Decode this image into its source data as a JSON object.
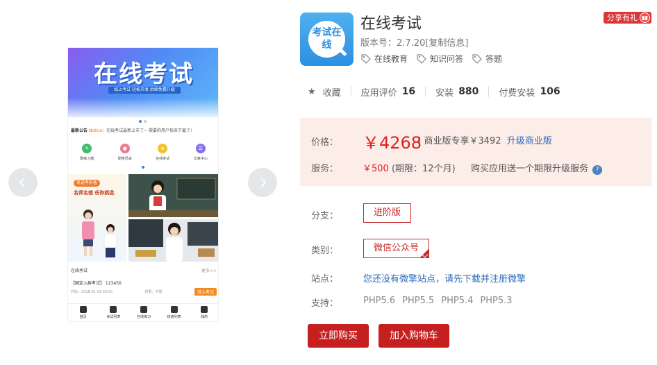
{
  "carousel": {
    "phone": {
      "banner_title": "在线考试",
      "banner_sub": "线上考试 轻松开发 后续免费升级",
      "notice_label": "最新公告",
      "notice_en": "Notice",
      "notice_text": "：在线考试最新上市了~ 需要的用户快来下载了!",
      "quick": [
        {
          "label": "刷练习题",
          "color": "#3fbf6a",
          "glyph": "✎"
        },
        {
          "label": "勤奋讯采",
          "color": "#f07a8a",
          "glyph": "●"
        },
        {
          "label": "在线考试",
          "color": "#f2c12a",
          "glyph": "★"
        },
        {
          "label": "文章中心",
          "color": "#8a6ff0",
          "glyph": "☰"
        }
      ],
      "promo_badge": "英语考前备",
      "promo_title": "名师名栽 任你挑选",
      "section_title": "在线考试",
      "section_more": "更多>>",
      "exam_title": "【国定入群考试】 123456",
      "exam_time": "开始：2018-01-09 00:00",
      "exam_duration": "时限：不限",
      "exam_enter": "进入考试",
      "tabs": [
        "首页",
        "考试列表",
        "在线练习",
        "班级列表",
        "我的"
      ]
    }
  },
  "app": {
    "icon_text": "考试在线",
    "title": "在线考试",
    "version": "版本号：2.7.20[复制信息]",
    "tags": [
      "在线教育",
      "知识问答",
      "答题"
    ],
    "share": "分享有礼"
  },
  "stats": {
    "favorite": "收藏",
    "rating_label": "应用评价",
    "rating_value": "16",
    "install_label": "安装",
    "install_value": "880",
    "paid_label": "付费安装",
    "paid_value": "106"
  },
  "price": {
    "label": "价格：",
    "value": "￥4268",
    "meta": "| 商业版专享￥3492",
    "upgrade": "升级商业版",
    "service_label": "服务：",
    "service_value": "￥500",
    "service_period": "(期限：12个月)",
    "service_note": "购买应用送一个期限升级服务",
    "help": "?"
  },
  "branch": {
    "label": "分支：",
    "value": "进阶版"
  },
  "category": {
    "label": "类别：",
    "value": "微信公众号"
  },
  "site": {
    "label": "站点：",
    "value": "您还没有微擎站点，请先下载并注册微擎"
  },
  "support": {
    "label": "支持：",
    "versions": [
      "PHP5.6",
      "PHP5.5",
      "PHP5.4",
      "PHP5.3"
    ]
  },
  "actions": {
    "buy": "立即购买",
    "cart": "加入购物车"
  },
  "colors": {
    "accent": "#c61f1f",
    "link": "#2d6bb8",
    "price_bg": "#fdede8",
    "app_icon": "#2d8fe0"
  }
}
